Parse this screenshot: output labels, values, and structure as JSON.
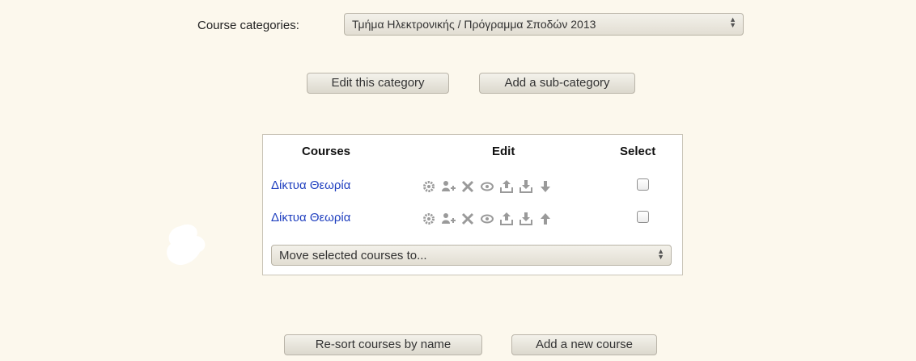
{
  "category": {
    "label": "Course categories:",
    "selected": "Τμήμα Ηλεκτρονικής / Πρόγραμμα Σποδών 2013"
  },
  "category_actions": {
    "edit_label": "Edit this category",
    "add_sub_label": "Add a sub-category"
  },
  "courses_table": {
    "headers": {
      "courses": "Courses",
      "edit": "Edit",
      "select": "Select"
    },
    "rows": [
      {
        "name": "Δίκτυα Θεωρία",
        "icons": [
          "settings-icon",
          "enrol-users-icon",
          "delete-icon",
          "visibility-icon",
          "backup-icon",
          "restore-icon",
          "move-down-icon"
        ],
        "checked": false
      },
      {
        "name": "Δίκτυα Θεωρία",
        "icons": [
          "settings-icon",
          "enrol-users-icon",
          "delete-icon",
          "visibility-icon",
          "backup-icon",
          "restore-icon",
          "move-up-icon"
        ],
        "checked": false
      }
    ],
    "move_select_label": "Move selected courses to..."
  },
  "bottom_actions": {
    "resort_label": "Re-sort courses by name",
    "add_course_label": "Add a new course"
  },
  "colors": {
    "background": "#fcf8ed",
    "link": "#1f3fbf",
    "icon": "#9a9a9a"
  }
}
